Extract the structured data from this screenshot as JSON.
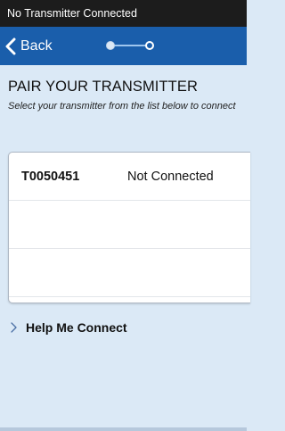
{
  "status_bar": {
    "text": "No Transmitter Connected"
  },
  "nav": {
    "back_label": "Back",
    "step_current": 2,
    "step_total": 2
  },
  "header": {
    "title": "PAIR YOUR TRANSMITTER",
    "subtitle": "Select your transmitter from the list below to connect"
  },
  "transmitters": [
    {
      "id": "T0050451",
      "status": "Not Connected"
    },
    {
      "id": "",
      "status": ""
    },
    {
      "id": "",
      "status": ""
    }
  ],
  "help": {
    "label": "Help Me Connect"
  },
  "colors": {
    "nav_bg": "#1a5eab",
    "page_bg": "#dbe9f6",
    "status_bg": "#1c1c1c"
  },
  "icons": {
    "back": "chevron-left-icon",
    "help": "chevron-right-icon"
  }
}
